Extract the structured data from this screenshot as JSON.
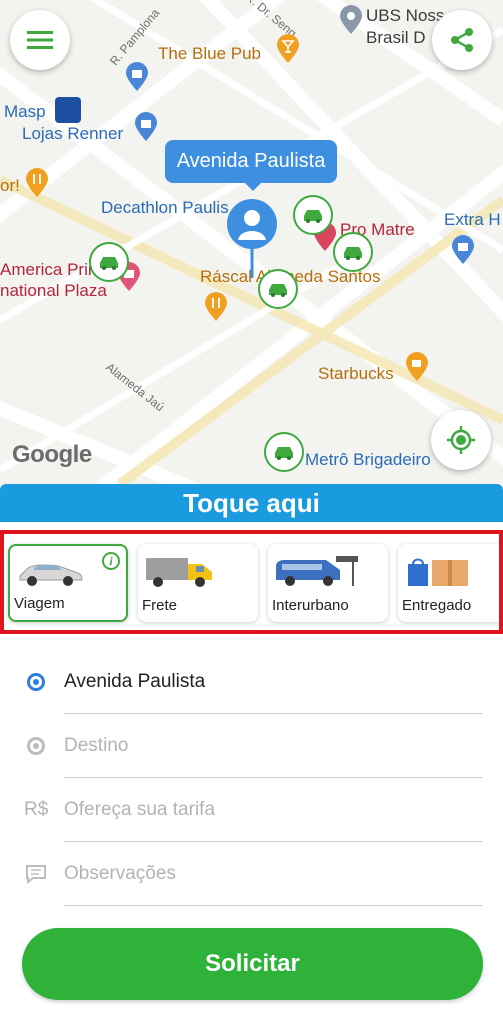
{
  "map": {
    "callout": "Avenida Paulista",
    "google_logo": "Google",
    "labels": {
      "masp": "Masp",
      "lojas_renner": "Lojas Renner",
      "blue_pub": "The Blue Pub",
      "ubs": "UBS Noss",
      "brasil": "Brasil D",
      "decathlon": "Decathlon Paulis",
      "pro_matre": "Pro Matre",
      "extra": "Extra H",
      "america_1": "America Prin",
      "america_2": "national Plaza",
      "rascal": "Ráscal Alameda Santos",
      "starbucks": "Starbucks",
      "metro": "Metrô Brigadeiro",
      "orr": "or!",
      "street_pamplona": "R. Pamplona",
      "street_seng": "R. Dr. Seng",
      "street_jau": "Alameda Jaú"
    }
  },
  "header": {
    "menu_icon": "menu-icon",
    "share_icon": "share-icon"
  },
  "tap_bar": "Toque aqui",
  "services": [
    {
      "label": "Viagem",
      "icon": "car-icon",
      "active": true
    },
    {
      "label": "Frete",
      "icon": "truck-icon",
      "active": false
    },
    {
      "label": "Interurbano",
      "icon": "van-icon",
      "active": false
    },
    {
      "label": "Entregado",
      "icon": "package-icon",
      "active": false
    }
  ],
  "form": {
    "origin": "Avenida Paulista",
    "destination_placeholder": "Destino",
    "currency": "R$",
    "fare_placeholder": "Ofereça sua tarifa",
    "notes_placeholder": "Observações"
  },
  "submit_label": "Solicitar",
  "colors": {
    "accent_green": "#2eb23a",
    "accent_blue": "#1a9be0",
    "highlight_red": "#e0141e"
  }
}
